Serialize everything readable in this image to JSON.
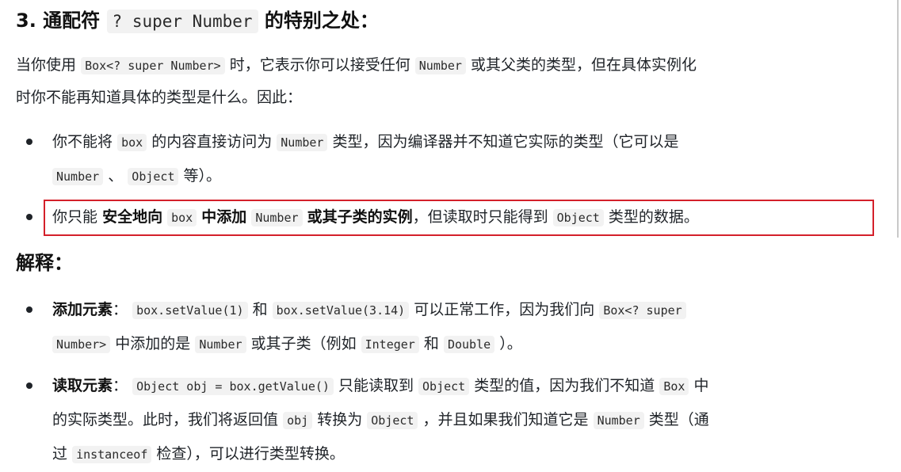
{
  "heading": {
    "prefix": "3. 通配符",
    "code": "? super Number",
    "suffix": "的特别之处："
  },
  "intro": {
    "t1": "当你使用",
    "c1": "Box<? super Number>",
    "t2": "时，它表示你可以接受任何",
    "c2": "Number",
    "t3": "或其父类的类型，但在具体实例化",
    "t4": "时你不能再知道具体的类型是什么。因此："
  },
  "bullets1": [
    {
      "t1": "你不能将",
      "c1": "box",
      "t2": "的内容直接访问为",
      "c2": "Number",
      "t3": "类型，因为编译器并不知道它实际的类型（它可以是",
      "c3": "Number",
      "t4": "、",
      "c4": "Object",
      "t5": "等）。"
    },
    {
      "t1": "你只能",
      "b1": "安全地向",
      "c1": "box",
      "b2": "中添加",
      "c2": "Number",
      "b3": "或其子类的实例",
      "t2": "，但读取时只能得到",
      "c3": "Object",
      "t3": "类型的数据。"
    }
  ],
  "explain_heading": "解释：",
  "bullets2": [
    {
      "b1": "添加元素",
      "t1": "：",
      "c1": "box.setValue(1)",
      "t2": "和",
      "c2": "box.setValue(3.14)",
      "t3": "可以正常工作，因为我们向",
      "c3a": "Box<? super",
      "c3b": "Number>",
      "t4": "中添加的是",
      "c4": "Number",
      "t5": "或其子类（例如",
      "c5": "Integer",
      "t6": "和",
      "c6": "Double",
      "t7": "）。"
    },
    {
      "b1": "读取元素",
      "t1": "：",
      "c1": "Object obj = box.getValue()",
      "t2": "只能读取到",
      "c2": "Object",
      "t3": "类型的值，因为我们不知道",
      "c3": "Box",
      "t4": "中",
      "t5": "的实际类型。此时，我们将返回值",
      "c4": "obj",
      "t6": "转换为",
      "c5": "Object",
      "t7": "，并且如果我们知道它是",
      "c6": "Number",
      "t8": "类型（通",
      "t9": "过",
      "c7": "instanceof",
      "t10": "检查），可以进行类型转换。"
    }
  ]
}
